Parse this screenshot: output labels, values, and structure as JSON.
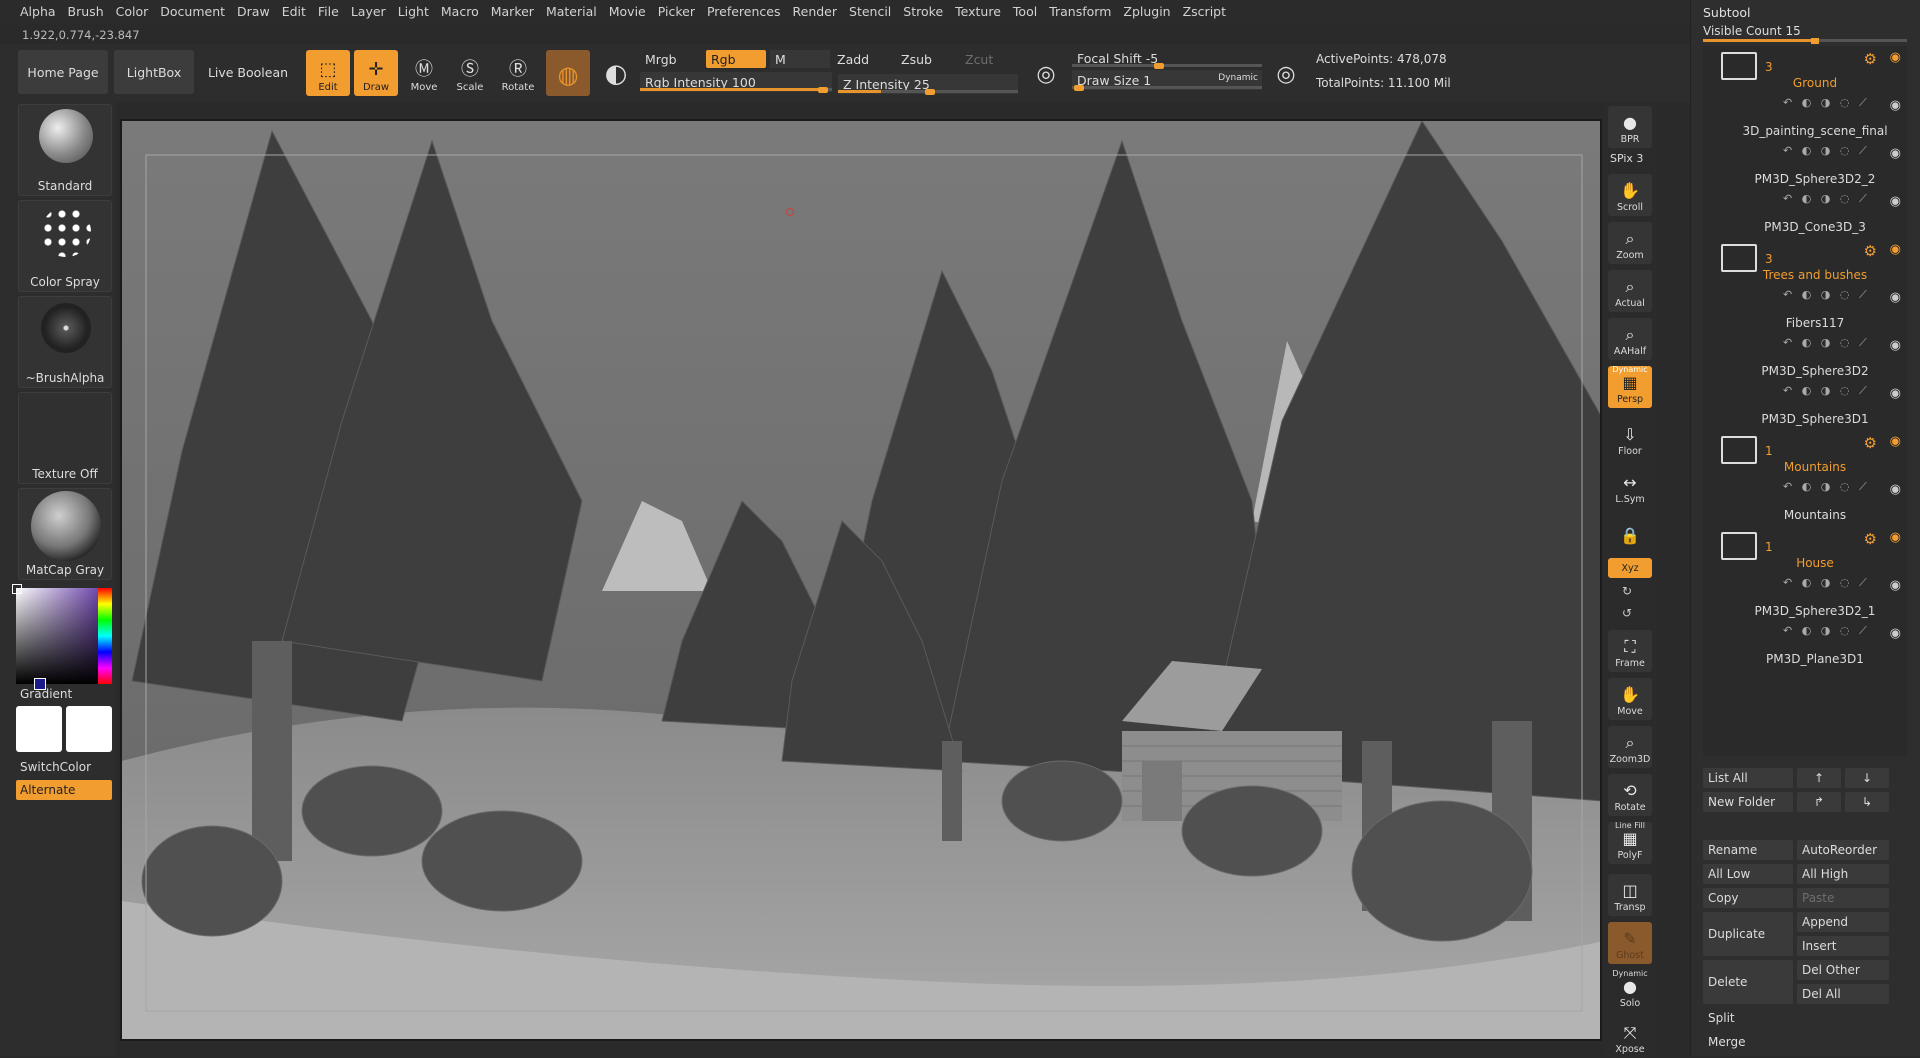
{
  "menu": [
    "Alpha",
    "Brush",
    "Color",
    "Document",
    "Draw",
    "Edit",
    "File",
    "Layer",
    "Light",
    "Macro",
    "Marker",
    "Material",
    "Movie",
    "Picker",
    "Preferences",
    "Render",
    "Stencil",
    "Stroke",
    "Texture",
    "Tool",
    "Transform",
    "Zplugin",
    "Zscript"
  ],
  "coords": "1.922,0.774,-23.847",
  "toolbar": {
    "home_page": "Home Page",
    "lightbox": "LightBox",
    "live_boolean": "Live Boolean",
    "edit": "Edit",
    "draw": "Draw",
    "move": "Move",
    "scale": "Scale",
    "rotate": "Rotate",
    "mrgb": "Mrgb",
    "rgb": "Rgb",
    "m": "M",
    "zadd": "Zadd",
    "zsub": "Zsub",
    "zcut": "Zcut",
    "rgb_intensity": "Rgb Intensity 100",
    "z_intensity": "Z Intensity 25",
    "focal_shift": "Focal Shift -5",
    "draw_size": "Draw Size 1",
    "dynamic": "Dynamic",
    "active_points": "ActivePoints: 478,078",
    "total_points": "TotalPoints: 11.100 Mil",
    "rgb_intensity_value": 100,
    "z_intensity_value": 25
  },
  "left": {
    "brush": "Standard",
    "stroke": "Color Spray",
    "alpha": "~BrushAlpha",
    "texture": "Texture Off",
    "material": "MatCap Gray",
    "gradient": "Gradient",
    "switch_color": "SwitchColor",
    "alternate": "Alternate"
  },
  "right_shelf": [
    "BPR",
    "SPix 3",
    "Scroll",
    "Zoom",
    "Actual",
    "AAHalf",
    "Persp",
    "Floor",
    "L.Sym",
    "Xyz",
    "Frame",
    "Move",
    "Zoom3D",
    "Rotate",
    "PolyF",
    "Transp",
    "Ghost",
    "Solo",
    "Xpose"
  ],
  "right_labels": {
    "dynamic": "Dynamic",
    "line_fill": "Line Fill"
  },
  "subtool": {
    "title": "Subtool",
    "visible_count": "Visible Count 15",
    "items": [
      {
        "type": "folder",
        "count": "3",
        "name": "Ground"
      },
      {
        "type": "tool",
        "name": "3D_painting_scene_final"
      },
      {
        "type": "tool",
        "name": "PM3D_Sphere3D2_2"
      },
      {
        "type": "tool",
        "name": "PM3D_Cone3D_3"
      },
      {
        "type": "folder",
        "count": "3",
        "name": "Trees and bushes"
      },
      {
        "type": "tool",
        "name": "Fibers117"
      },
      {
        "type": "tool",
        "name": "PM3D_Sphere3D2"
      },
      {
        "type": "tool",
        "name": "PM3D_Sphere3D1"
      },
      {
        "type": "folder",
        "count": "1",
        "name": "Mountains"
      },
      {
        "type": "tool",
        "name": "Mountains"
      },
      {
        "type": "folder",
        "count": "1",
        "name": "House"
      },
      {
        "type": "tool",
        "name": "PM3D_Sphere3D2_1"
      },
      {
        "type": "tool",
        "name": "PM3D_Plane3D1"
      }
    ],
    "buttons": {
      "list_all": "List All",
      "new_folder": "New Folder",
      "rename": "Rename",
      "auto_reorder": "AutoReorder",
      "all_low": "All Low",
      "all_high": "All High",
      "copy": "Copy",
      "paste": "Paste",
      "duplicate": "Duplicate",
      "append": "Append",
      "insert": "Insert",
      "delete": "Delete",
      "del_other": "Del Other",
      "del_all": "Del All",
      "split": "Split",
      "merge": "Merge"
    }
  },
  "colors": {
    "accent": "#f29d2f",
    "panel": "#2e2e2e",
    "viewport": "#6b6b6b"
  }
}
